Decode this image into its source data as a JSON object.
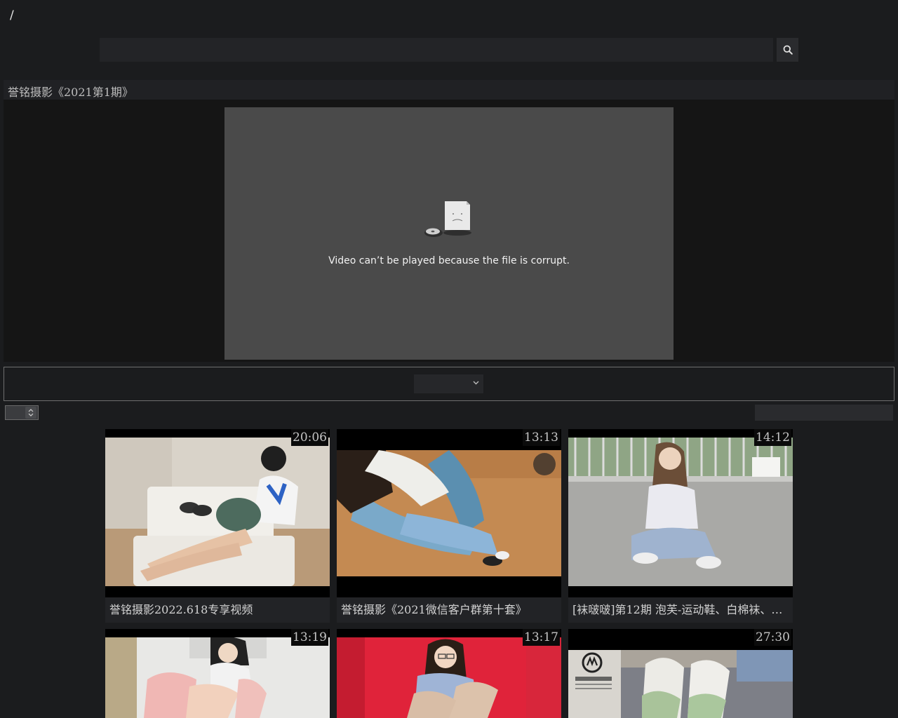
{
  "header": {
    "breadcrumb": "/",
    "search": {
      "value": "",
      "placeholder": ""
    }
  },
  "video": {
    "title": "誉铭摄影《2021第1期》",
    "error_message": "Video can’t be played because the file is corrupt."
  },
  "controls": {
    "select_value": "",
    "stepper_value": "",
    "filter_value": ""
  },
  "icons": {
    "search": "search-icon",
    "broken_video": "broken-file-icon",
    "dropdown": "chevron-down-icon",
    "stepper": "up-down-arrows-icon"
  },
  "videos": [
    {
      "duration": "20:06",
      "title": "誉铭摄影2022.618专享视频"
    },
    {
      "duration": "13:13",
      "title": "誉铭摄影《2021微信客户群第十套》"
    },
    {
      "duration": "14:12",
      "title": "[袜啵啵]第12期 泡芙-运动鞋、白棉袜、…"
    },
    {
      "duration": "13:19",
      "title": ""
    },
    {
      "duration": "13:17",
      "title": ""
    },
    {
      "duration": "27:30",
      "title": ""
    }
  ],
  "colors": {
    "background": "#1b1c1e",
    "video_placeholder": "#4a4a4a"
  }
}
